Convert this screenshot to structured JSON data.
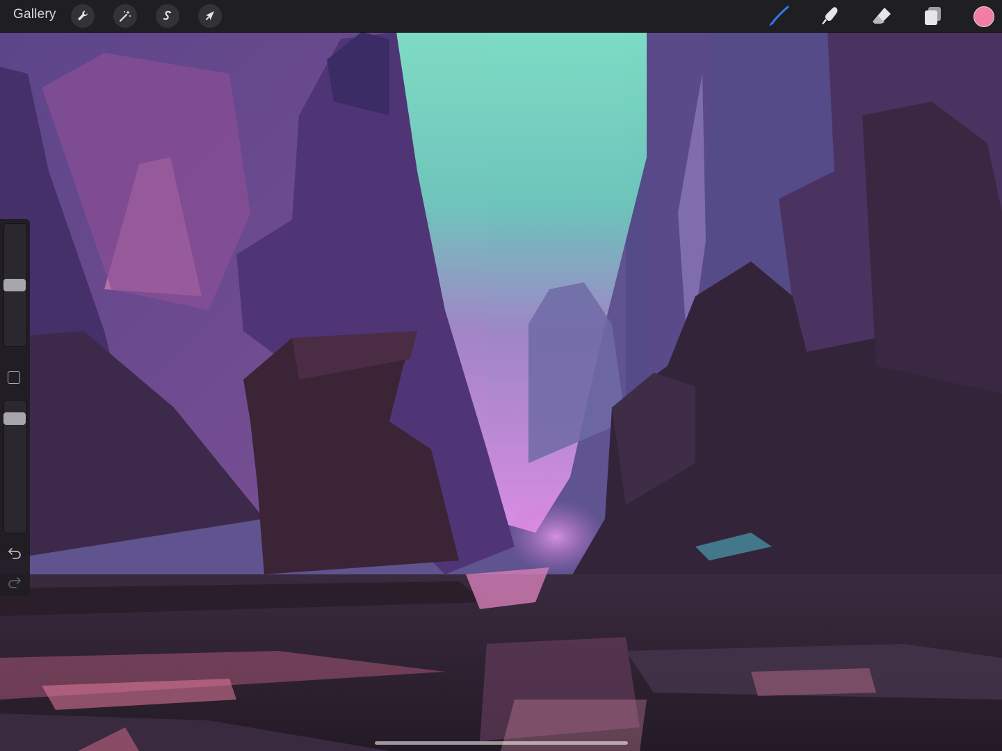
{
  "topbar": {
    "gallery_label": "Gallery",
    "left_tools": [
      {
        "name": "actions",
        "icon": "wrench-icon"
      },
      {
        "name": "adjustments",
        "icon": "magic-wand-icon"
      },
      {
        "name": "selection",
        "icon": "selection-s-icon"
      },
      {
        "name": "transform",
        "icon": "arrow-cursor-icon"
      }
    ],
    "right_tools": [
      {
        "name": "brush",
        "icon": "brush-icon",
        "active": true
      },
      {
        "name": "smudge",
        "icon": "smudge-icon"
      },
      {
        "name": "eraser",
        "icon": "eraser-icon"
      },
      {
        "name": "layers",
        "icon": "layers-icon"
      }
    ],
    "active_color": "#f27ea6",
    "active_tool_color": "#2f7bf5"
  },
  "sidebar": {
    "brush_size_level": 0.5,
    "opacity_level": 0.1,
    "modify_button": "square-modify-icon",
    "undo": "undo-icon",
    "redo": "redo-icon"
  },
  "canvas": {
    "content": "painting",
    "palette": [
      "#5a4a86",
      "#7a4c86",
      "#6fd6b9",
      "#c57ad6",
      "#2a1e2c",
      "#e27a9a"
    ]
  }
}
